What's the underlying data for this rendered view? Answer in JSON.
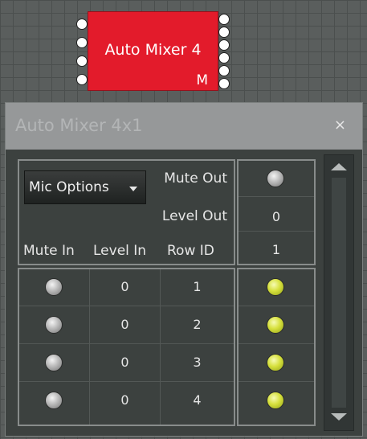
{
  "block": {
    "title": "Auto Mixer 4",
    "badge": "M"
  },
  "dialog": {
    "title": "Auto Mixer 4x1",
    "close_icon": "×",
    "mic_options_label": "Mic Options",
    "mute_out_label": "Mute Out",
    "level_out_label": "Level Out",
    "level_out_value": "0",
    "row_id_value": "1",
    "mute_out_state": "off",
    "columns": {
      "mute_in": "Mute In",
      "level_in": "Level In",
      "row_id": "Row ID"
    },
    "rows": [
      {
        "mute_state": "off",
        "level": "0",
        "id": "1",
        "gate_state": "on"
      },
      {
        "mute_state": "off",
        "level": "0",
        "id": "2",
        "gate_state": "on"
      },
      {
        "mute_state": "off",
        "level": "0",
        "id": "3",
        "gate_state": "on"
      },
      {
        "mute_state": "off",
        "level": "0",
        "id": "4",
        "gate_state": "on"
      }
    ]
  },
  "colors": {
    "block_red": "#e31b2b",
    "led_off": "#b9b9b9",
    "led_on": "#d6e03c",
    "dialog_bg": "#3c413f"
  }
}
